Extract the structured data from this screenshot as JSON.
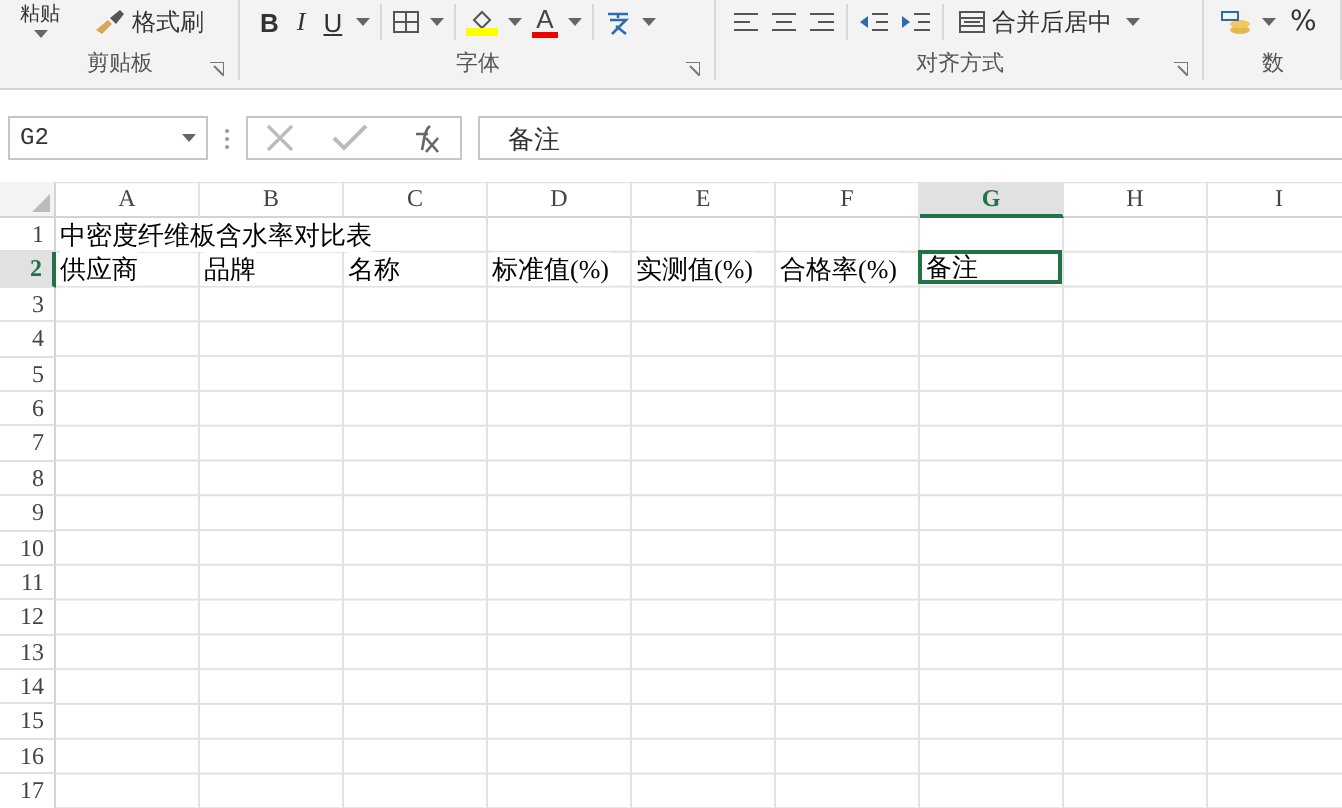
{
  "ribbon": {
    "groups": [
      {
        "kind": "clipboard",
        "label": "剪贴板",
        "buttons": [
          "粘贴",
          "格式刷"
        ]
      },
      {
        "kind": "font",
        "label": "字体",
        "buttons": [
          "B",
          "I",
          "U",
          "A"
        ]
      },
      {
        "kind": "align",
        "label": "对齐方式",
        "buttons": [
          "合并后居中"
        ]
      },
      {
        "kind": "number",
        "label": "数",
        "buttons": [
          "%"
        ]
      }
    ]
  },
  "formula_bar": {
    "name_box": "G2",
    "value": "备注"
  },
  "sheet": {
    "columns": [
      {
        "label": "A",
        "selected": false
      },
      {
        "label": "B",
        "selected": false
      },
      {
        "label": "C",
        "selected": false
      },
      {
        "label": "D",
        "selected": false
      },
      {
        "label": "E",
        "selected": false
      },
      {
        "label": "F",
        "selected": false
      },
      {
        "label": "G",
        "selected": true
      },
      {
        "label": "H",
        "selected": false
      },
      {
        "label": "I",
        "selected": false
      }
    ],
    "rows": [
      {
        "label": "1",
        "selected": false,
        "cells": [
          {
            "text": "中密度纤维板含水率对比表",
            "selected": false
          }
        ]
      },
      {
        "label": "2",
        "selected": true,
        "cells": [
          {
            "text": "供应商",
            "selected": false
          },
          {
            "text": "品牌",
            "selected": false
          },
          {
            "text": "名称",
            "selected": false
          },
          {
            "text": "标准值(%)",
            "selected": false
          },
          {
            "text": "实测值(%)",
            "selected": false
          },
          {
            "text": "合格率(%)",
            "selected": false
          },
          {
            "text": "备注",
            "selected": true
          }
        ]
      },
      {
        "label": "3",
        "selected": false,
        "cells": []
      },
      {
        "label": "4",
        "selected": false,
        "cells": []
      },
      {
        "label": "5",
        "selected": false,
        "cells": []
      },
      {
        "label": "6",
        "selected": false,
        "cells": []
      },
      {
        "label": "7",
        "selected": false,
        "cells": []
      },
      {
        "label": "8",
        "selected": false,
        "cells": []
      },
      {
        "label": "9",
        "selected": false,
        "cells": []
      },
      {
        "label": "10",
        "selected": false,
        "cells": []
      },
      {
        "label": "11",
        "selected": false,
        "cells": []
      },
      {
        "label": "12",
        "selected": false,
        "cells": []
      },
      {
        "label": "13",
        "selected": false,
        "cells": []
      },
      {
        "label": "14",
        "selected": false,
        "cells": []
      },
      {
        "label": "15",
        "selected": false,
        "cells": []
      },
      {
        "label": "16",
        "selected": false,
        "cells": []
      },
      {
        "label": "17",
        "selected": false,
        "cells": []
      }
    ]
  }
}
